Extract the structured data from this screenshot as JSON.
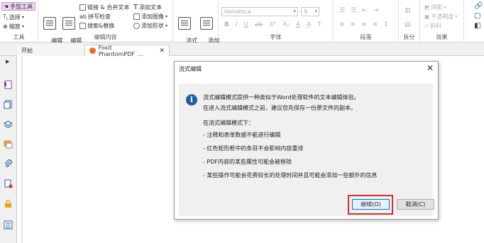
{
  "ribbon": {
    "tools": {
      "hand": "手型工具",
      "select": "选择",
      "zoom": "缩放",
      "group": "工具"
    },
    "edit": {
      "edit_text": "编辑\n文本",
      "edit_object": "编辑\n对象",
      "link_merge": "链接 & 合并文本",
      "spell_check": "拼写检查",
      "find_replace": "搜索&替换",
      "add_text": "添加文本",
      "add_image": "添加图像",
      "add_shape": "添加形状",
      "group": "编辑内容"
    },
    "flow": {
      "flow_edit": "流式\n编辑",
      "add_textbox": "添加\n文本框"
    },
    "font": {
      "name": "Helvetica",
      "size": "9",
      "group": "字体"
    },
    "paragraph": {
      "group": "段落"
    },
    "split": {
      "group": "拆分"
    },
    "effects": {
      "shadow": "阴影",
      "opacity": "不透明度",
      "skew": "斜料",
      "group": "效果"
    }
  },
  "tabs": {
    "start": "开始",
    "doc": "Foxit PhantomPDF_..."
  },
  "dialog": {
    "title": "流式编辑",
    "lines": [
      "流式编辑模式提供一种类似于Word处理软件的文本编辑体验。",
      "在进入流式编辑模式之前，建议您先保存一份原文件的副本。",
      "在流式编辑模式下：",
      "- 注释和表单数据不能进行编辑",
      "- 红色矩形框中的条目不会影响内容重排",
      "- PDF内容的某些属性可能会被移除",
      "- 某些操作可能会花费较长的处理时间并且可能会添加一些额外的信息"
    ],
    "continue_label": "继续(O)",
    "cancel_label": "取消(C)"
  }
}
